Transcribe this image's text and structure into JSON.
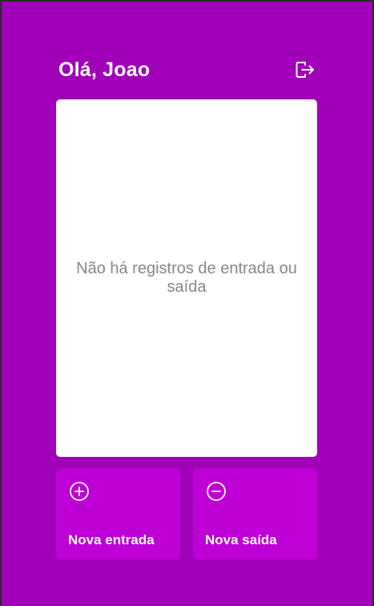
{
  "header": {
    "greeting": "Olá, Joao",
    "logout_icon": "logout-icon"
  },
  "records": {
    "empty_message": "Não há registros de entrada ou saída"
  },
  "actions": {
    "new_entry": {
      "label": "Nova entrada",
      "icon": "plus-circle-icon"
    },
    "new_exit": {
      "label": "Nova saída",
      "icon": "minus-circle-icon"
    }
  },
  "colors": {
    "background": "#a000b8",
    "button": "#be00d6",
    "panel": "#ffffff",
    "muted_text": "#868686"
  }
}
